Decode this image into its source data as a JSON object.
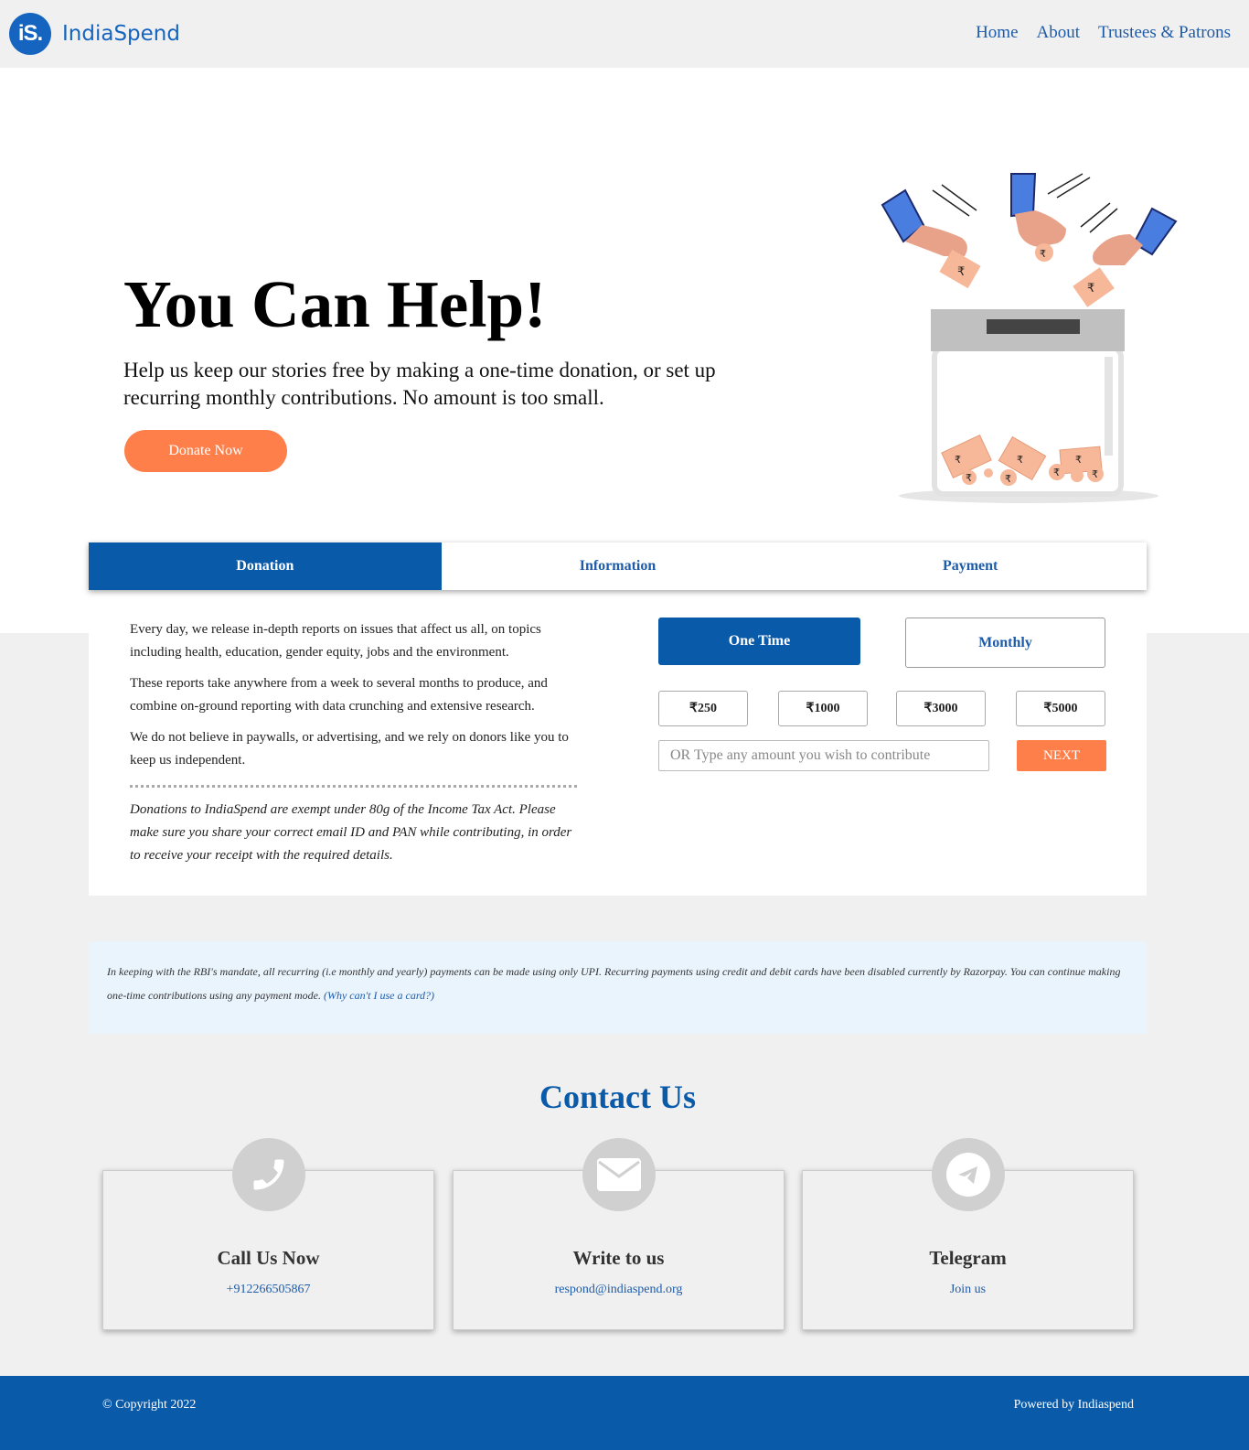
{
  "header": {
    "logo_mark": "iS.",
    "logo_text": "IndiaSpend",
    "nav": [
      "Home",
      "About",
      "Trustees & Patrons"
    ]
  },
  "hero": {
    "title": "You Can Help!",
    "subtitle": "Help us keep our stories free by making a one-time donation, or set up recurring monthly contributions. No amount is too small.",
    "cta": "Donate Now"
  },
  "tabs": [
    "Donation",
    "Information",
    "Payment"
  ],
  "info": {
    "paragraphs": [
      "Every day, we release in-depth reports on issues that affect us all, on topics including health, education, gender equity, jobs and the environment.",
      "These reports take anywhere from a week to several months to produce, and combine on-ground reporting with data crunching and extensive research.",
      "We do not believe in paywalls, or advertising, and we rely on donors like you to keep us independent."
    ],
    "note": "Donations to IndiaSpend are exempt under 80g of the Income Tax Act. Please make sure you share your correct email ID and PAN while contributing, in order to receive your receipt with the required details."
  },
  "donation": {
    "one_time": "One Time",
    "monthly": "Monthly",
    "amounts": [
      "₹250",
      "₹1000",
      "₹3000",
      "₹5000"
    ],
    "placeholder": "OR Type any amount you wish to contribute",
    "next": "NEXT"
  },
  "notice": {
    "text": "In keeping with the RBI's mandate, all recurring (i.e monthly and yearly) payments can be made using only UPI. Recurring payments using credit and debit cards have been disabled currently by Razorpay. You can continue making one-time contributions using any payment mode. ",
    "link": "(Why can't I use a card?)"
  },
  "contact": {
    "title": "Contact Us",
    "cards": [
      {
        "title": "Call Us Now",
        "link": "+912266505867",
        "icon": "phone-icon"
      },
      {
        "title": "Write to us",
        "link": "respond@indiaspend.org",
        "icon": "envelope-icon"
      },
      {
        "title": "Telegram",
        "link": "Join us",
        "icon": "telegram-icon"
      }
    ]
  },
  "footer": {
    "copyright": "© Copyright 2022",
    "powered": "Powered by Indiaspend"
  },
  "colors": {
    "brand_blue": "#0a5aaa",
    "accent_orange": "#ff7f4a",
    "notice_bg": "#eaf4fd"
  }
}
